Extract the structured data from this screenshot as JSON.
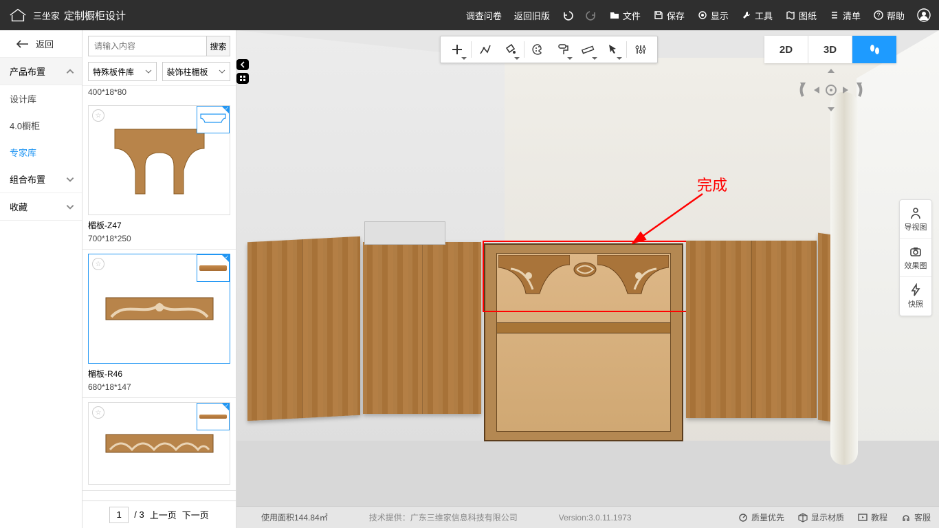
{
  "app": {
    "brand": "三坐家",
    "title": "定制橱柜设计"
  },
  "topmenu": {
    "survey": "调查问卷",
    "oldver": "返回旧版",
    "file": "文件",
    "save": "保存",
    "display": "显示",
    "tools": "工具",
    "drawing": "图纸",
    "list": "清单",
    "help": "帮助"
  },
  "left": {
    "back": "返回",
    "cat_product": "产品布置",
    "subs": {
      "design_lib": "设计库",
      "cupboard4": "4.0橱柜",
      "expert": "专家库"
    },
    "cat_combo": "组合布置",
    "cat_fav": "收藏"
  },
  "lib": {
    "search_placeholder": "请输入内容",
    "search_btn": "搜索",
    "sel1": "特殊板件库",
    "sel2": "装饰柱楣板",
    "top_dims": "400*18*80",
    "items": [
      {
        "name": "楣板-Z47",
        "dims": "700*18*250"
      },
      {
        "name": "楣板-R46",
        "dims": "680*18*147"
      }
    ],
    "pager": {
      "page": "1",
      "total": "/ 3",
      "prev": "上一页",
      "next": "下一页"
    }
  },
  "viewmode": {
    "d2": "2D",
    "d3": "3D",
    "walk_icon": "walk"
  },
  "rdock": {
    "nav": "导视图",
    "effect": "效果图",
    "snap": "快照"
  },
  "annotation": {
    "done": "完成"
  },
  "status": {
    "area": "使用面积144.84㎡",
    "tech": "技术提供：广东三维家信息科技有限公司",
    "version": "Version:3.0.11.1973",
    "quality": "质量优先",
    "material": "显示材质",
    "tutorial": "教程",
    "service": "客服"
  }
}
